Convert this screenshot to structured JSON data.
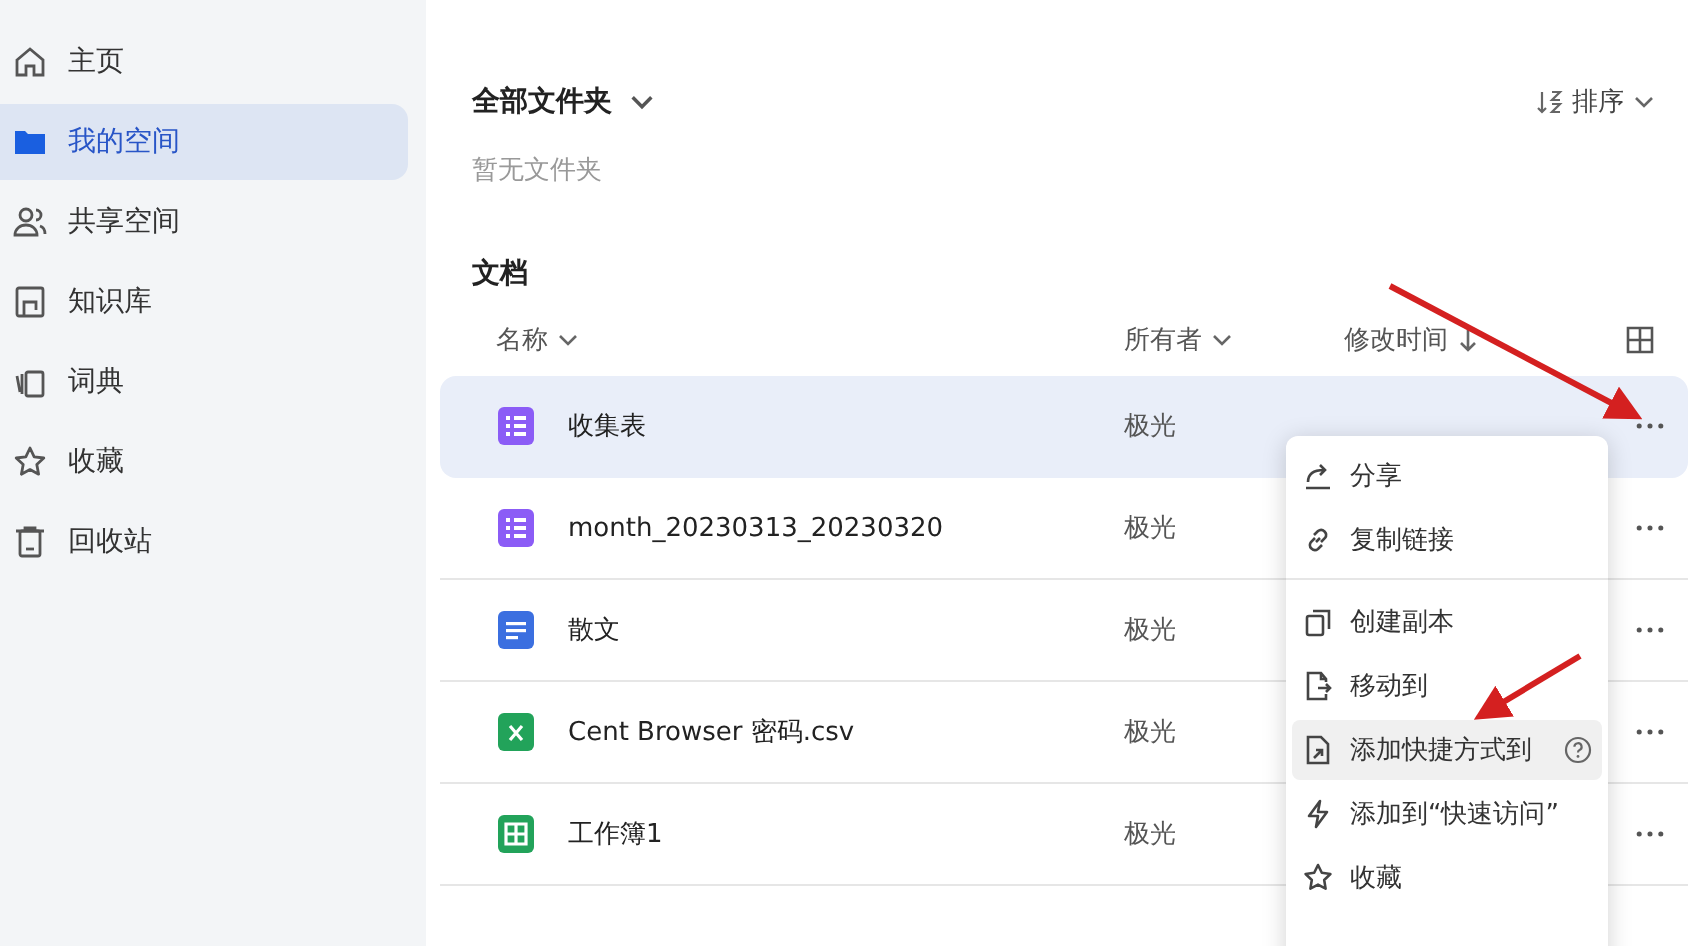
{
  "sidebar": {
    "items": [
      {
        "label": "主页",
        "kind": "home",
        "selected": false
      },
      {
        "label": "我的空间",
        "kind": "folder",
        "selected": true
      },
      {
        "label": "共享空间",
        "kind": "people",
        "selected": false
      },
      {
        "label": "知识库",
        "kind": "book",
        "selected": false
      },
      {
        "label": "词典",
        "kind": "dict",
        "selected": false
      },
      {
        "label": "收藏",
        "kind": "star",
        "selected": false
      },
      {
        "label": "回收站",
        "kind": "trash",
        "selected": false
      }
    ]
  },
  "folders": {
    "title": "全部文件夹",
    "empty": "暂无文件夹",
    "sort": "排序"
  },
  "documents": {
    "title": "文档",
    "columns": [
      {
        "label": "名称",
        "kind": "chevron"
      },
      {
        "label": "所有者",
        "kind": "chevron"
      },
      {
        "label": "修改时间",
        "kind": "down"
      }
    ],
    "rows": [
      {
        "name": "收集表",
        "kind": "form",
        "owner": "极光",
        "selected": true
      },
      {
        "name": "month_20230313_20230320",
        "kind": "form",
        "owner": "极光",
        "selected": false
      },
      {
        "name": "散文",
        "kind": "doc",
        "owner": "极光",
        "selected": false
      },
      {
        "name": "Cent Browser 密码.csv",
        "kind": "csv",
        "owner": "极光",
        "selected": false
      },
      {
        "name": "工作簿1",
        "kind": "sheet",
        "owner": "极光",
        "selected": false
      }
    ]
  },
  "context_menu": {
    "groups": [
      [
        {
          "label": "分享",
          "kind": "share",
          "hovered": false
        },
        {
          "label": "复制链接",
          "kind": "link",
          "hovered": false
        }
      ],
      [
        {
          "label": "创建副本",
          "kind": "copy",
          "hovered": false
        },
        {
          "label": "移动到",
          "kind": "move",
          "hovered": false
        },
        {
          "label": "添加快捷方式到",
          "kind": "shortcut",
          "hovered": true
        },
        {
          "label": "添加到“快速访问”",
          "kind": "bolt",
          "hovered": false
        },
        {
          "label": "收藏",
          "kind": "star",
          "hovered": false
        }
      ]
    ]
  }
}
